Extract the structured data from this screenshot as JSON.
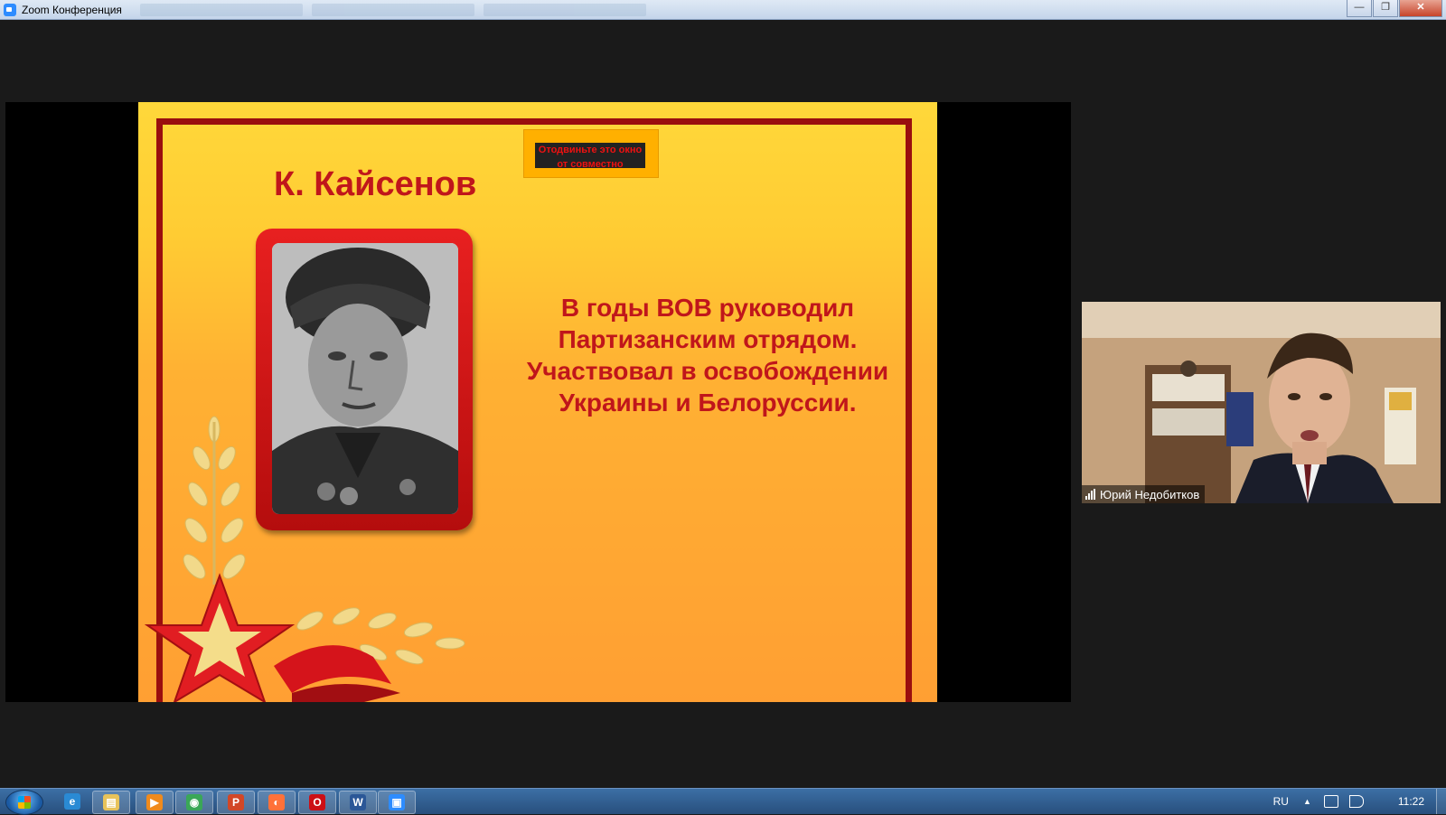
{
  "window": {
    "title": "Zoom Конференция",
    "minimize_glyph": "—",
    "maximize_glyph": "❐",
    "close_glyph": "✕"
  },
  "slide": {
    "title": "К. Кайсенов",
    "share_warning": "Отодвиньте это окно от совместно",
    "text": "В годы ВОВ руководил\nПартизанским отрядом.\nУчаствовал в освобождении\nУкраины и Белоруссии.",
    "colors": {
      "accent_red": "#c0161b",
      "frame_red": "#9a0e0e",
      "bg_top": "#ffd83a",
      "bg_bottom": "#ff9f33"
    }
  },
  "participant": {
    "name": "Юрий Недобитков"
  },
  "taskbar": {
    "apps": [
      {
        "name": "internet-explorer",
        "glyph": "e",
        "color": "#2a8ad4"
      },
      {
        "name": "file-explorer",
        "glyph": "▤",
        "color": "#e8c35a"
      },
      {
        "name": "media-player",
        "glyph": "▶",
        "color": "#f08a1c"
      },
      {
        "name": "chrome",
        "glyph": "◉",
        "color": "#3aa757"
      },
      {
        "name": "powerpoint",
        "glyph": "P",
        "color": "#d24726"
      },
      {
        "name": "firefox",
        "glyph": "◐",
        "color": "#ff7139"
      },
      {
        "name": "opera",
        "glyph": "O",
        "color": "#cc0f16"
      },
      {
        "name": "word",
        "glyph": "W",
        "color": "#2b5797"
      },
      {
        "name": "zoom",
        "glyph": "▣",
        "color": "#2d8cff"
      }
    ],
    "language": "RU",
    "tray_arrow": "▲",
    "clock": "11:22"
  }
}
